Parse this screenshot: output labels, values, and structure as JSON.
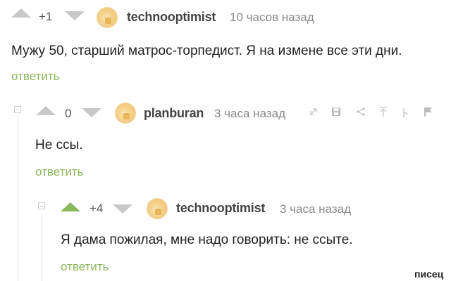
{
  "comments": [
    {
      "score": "+1",
      "username": "technooptimist",
      "time": "10 часов назад",
      "text": "Мужу 50, старший матрос-торпедист. Я на измене все эти дни.",
      "reply_label": "ответить"
    },
    {
      "score": "0",
      "username": "planburan",
      "time": "3 часа назад",
      "text": "Не ссы.",
      "reply_label": "ответить",
      "tools": [
        "link-icon",
        "save-icon",
        "share-icon",
        "upvote-arrow-icon",
        "flag-hint-icon",
        "report-flag-icon"
      ]
    },
    {
      "score": "+4",
      "username": "technooptimist",
      "time": "3 часа назад",
      "text": "Я дама пожилая, мне надо говорить: не ссыте.",
      "reply_label": "ответить"
    }
  ],
  "watermark": "писец",
  "colors": {
    "reply_green": "#8ab85a",
    "vote_gray": "#c8c8c8",
    "vote_active_green": "#8ab85a"
  }
}
